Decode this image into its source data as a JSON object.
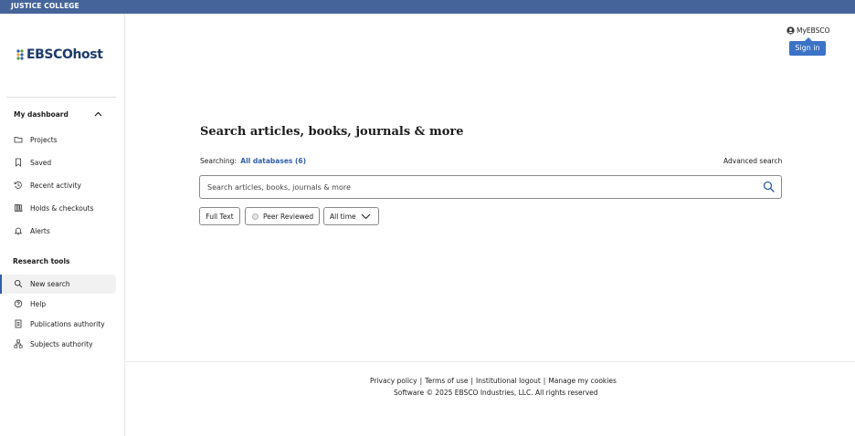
{
  "topbar": {
    "institution": "JUSTICE COLLEGE"
  },
  "brand": {
    "logo_text": "EBSCOhost"
  },
  "sidebar": {
    "dashboard_heading": "My dashboard",
    "dashboard_items": [
      {
        "label": "Projects",
        "icon": "folder-icon"
      },
      {
        "label": "Saved",
        "icon": "bookmark-icon"
      },
      {
        "label": "Recent activity",
        "icon": "history-icon"
      },
      {
        "label": "Holds & checkouts",
        "icon": "books-icon"
      },
      {
        "label": "Alerts",
        "icon": "bell-icon"
      }
    ],
    "tools_heading": "Research tools",
    "tools_items": [
      {
        "label": "New search",
        "icon": "search-icon",
        "active": true
      },
      {
        "label": "Help",
        "icon": "help-icon"
      },
      {
        "label": "Publications authority",
        "icon": "document-icon"
      },
      {
        "label": "Subjects authority",
        "icon": "hierarchy-icon"
      }
    ]
  },
  "account": {
    "myebsco_label": "MyEBSCO",
    "signin_label": "Sign in"
  },
  "search": {
    "heading": "Search articles, books, journals & more",
    "searching_label": "Searching:",
    "databases_link": "All databases (6)",
    "advanced_label": "Advanced search",
    "placeholder": "Search articles, books, journals & more",
    "filters": {
      "full_text": "Full Text",
      "peer_reviewed": "Peer Reviewed",
      "time": "All time"
    }
  },
  "footer": {
    "links": [
      "Privacy policy",
      "Terms of use",
      "Institutional logout",
      "Manage my cookies"
    ],
    "copyright": "Software © 2025 EBSCO Industries, LLC. All rights reserved"
  },
  "colors": {
    "topbar": "#456499",
    "accent": "#2f5ea8",
    "signin": "#3b73c6"
  }
}
